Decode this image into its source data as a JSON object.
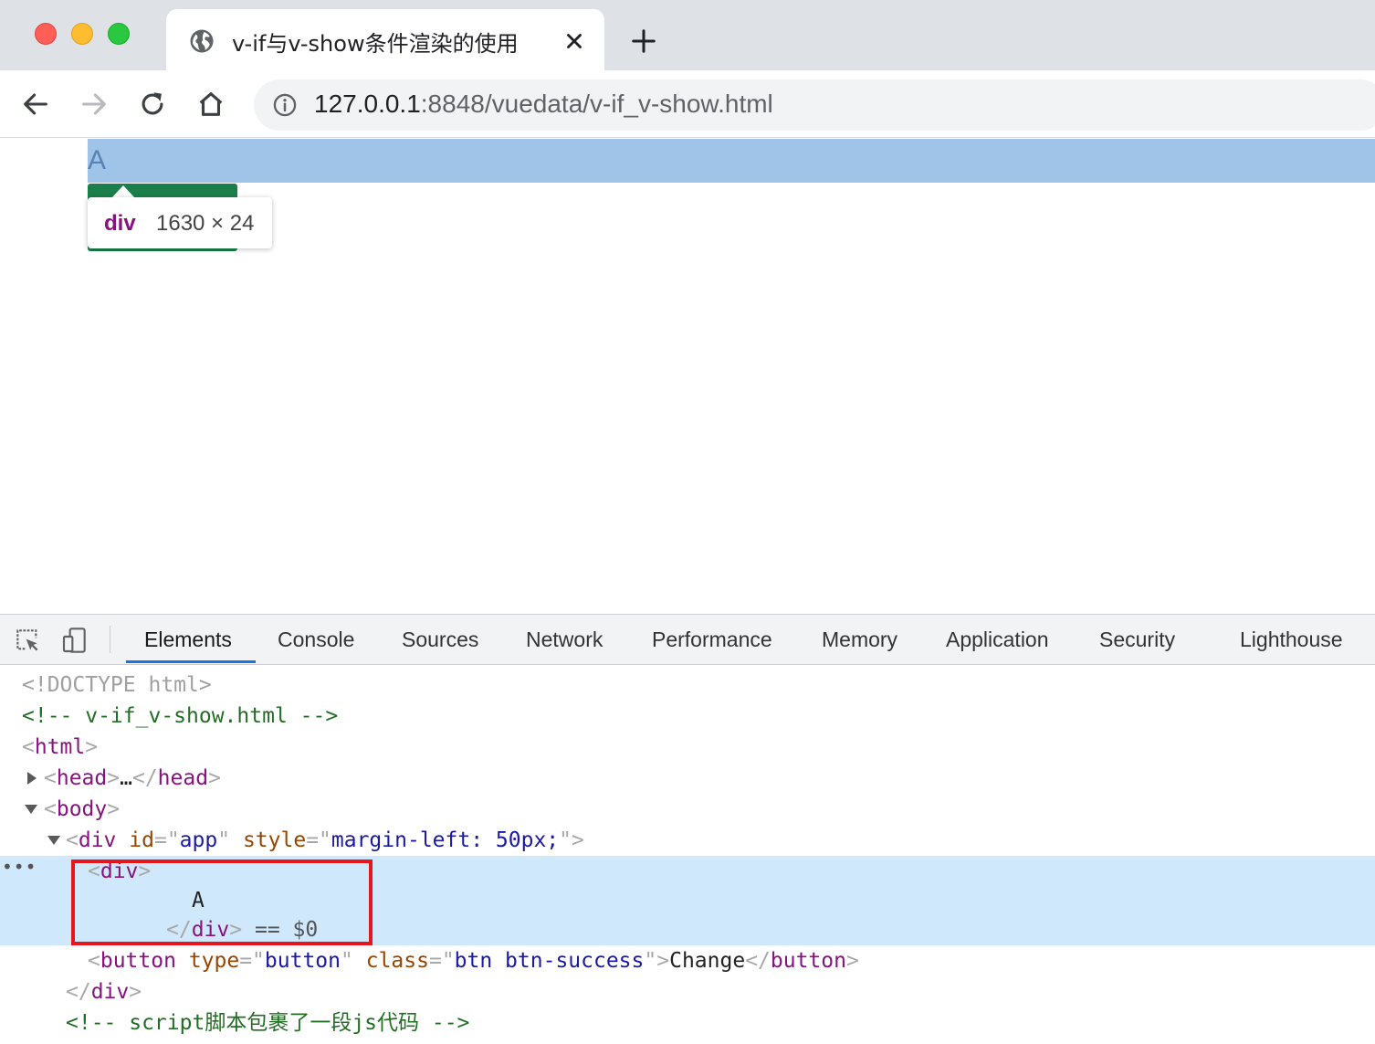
{
  "browser": {
    "tab": {
      "title": "v-if与v-show条件渲染的使用",
      "favicon": "globe-icon"
    },
    "url": {
      "host": "127.0.0.1",
      "rest": ":8848/vuedata/v-if_v-show.html"
    }
  },
  "page": {
    "text": "A",
    "tooltip": {
      "tag": "div",
      "size": "1630 × 24"
    }
  },
  "devtools": {
    "tabs": [
      "Elements",
      "Console",
      "Sources",
      "Network",
      "Performance",
      "Memory",
      "Application",
      "Security",
      "Lighthouse"
    ],
    "active_tab": "Elements",
    "dom": {
      "doctype": "<!DOCTYPE html>",
      "comment1": "<!-- v-if_v-show.html -->",
      "html_open": "html",
      "head": "head",
      "head_ellipsis": "…",
      "body": "body",
      "div_tag": "div",
      "div_attr_id": "id",
      "div_attr_id_val": "app",
      "div_attr_style": "style",
      "div_attr_style_val": "margin-left: 50px;",
      "inner_div": "div",
      "inner_text": "A",
      "selected_marker": "== $0",
      "button_tag": "button",
      "button_attr_type": "type",
      "button_attr_type_val": "button",
      "button_attr_class": "class",
      "button_attr_class_val": "btn btn-success",
      "button_text": "Change",
      "close_div": "div",
      "comment2": "<!-- script脚本包裹了一段js代码 -->"
    }
  },
  "colors": {
    "tag": "#881280",
    "attr": "#994500",
    "value": "#1a1aa6",
    "comment": "#236e25",
    "highlight": "#red"
  }
}
